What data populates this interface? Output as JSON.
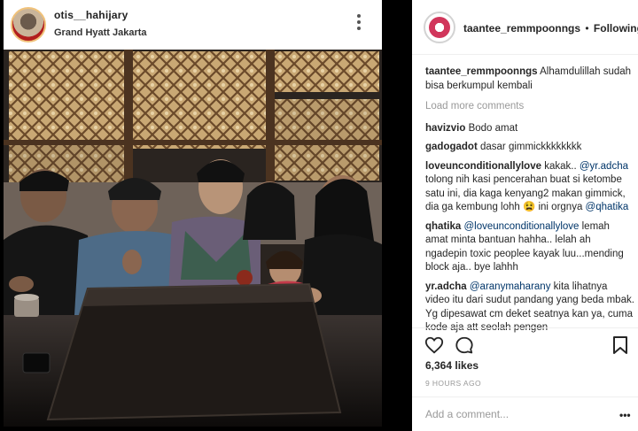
{
  "inner_post": {
    "username": "otis__hahijary",
    "location": "Grand Hyatt Jakarta"
  },
  "header": {
    "username": "taantee_remmpoonngs",
    "separator": "•",
    "follow_status": "Following"
  },
  "comments": [
    {
      "user": "taantee_remmpoonngs",
      "parts": [
        {
          "text": "Alhamdulillah sudah bisa berkumpul kembali"
        }
      ]
    },
    {
      "user": "havizvio",
      "parts": [
        {
          "text": "Bodo amat"
        }
      ]
    },
    {
      "user": "gadogadot",
      "parts": [
        {
          "text": "dasar gimmickkkkkkkk"
        }
      ]
    },
    {
      "user": "loveunconditionallylove",
      "parts": [
        {
          "text": "kakak.. "
        },
        {
          "mention": "@yr.adcha"
        },
        {
          "text": " tolong nih kasi pencerahan buat si ketombe satu ini, dia kaga kenyang2 makan gimmick, dia ga kembung lohh 😫 ini orgnya "
        },
        {
          "mention": "@qhatika"
        }
      ]
    },
    {
      "user": "qhatika",
      "parts": [
        {
          "mention": "@loveunconditionallylove"
        },
        {
          "text": " lemah amat minta bantuan hahha.. lelah ah ngadepin toxic peoplee kayak luu...mending block aja.. bye lahhh"
        }
      ]
    },
    {
      "user": "yr.adcha",
      "parts": [
        {
          "mention": "@aranymaharany"
        },
        {
          "text": " kita lihatnya video itu dari sudut pandang yang beda mbak. Yg dipesawat cm deket seatnya kan ya, cuma kode aja att seolah pengen"
        }
      ]
    }
  ],
  "load_more": "Load more comments",
  "likes": "6,364 likes",
  "timestamp": "9 HOURS AGO",
  "add_comment": {
    "placeholder": "Add a comment...",
    "more": "•••"
  },
  "icons": {
    "like": "heart-icon",
    "comment": "comment-bubble-icon",
    "save": "bookmark-icon",
    "options": "more-options-icon"
  },
  "colors": {
    "mention": "#003569",
    "muted": "#999999",
    "text": "#262626",
    "background": "#000000"
  }
}
